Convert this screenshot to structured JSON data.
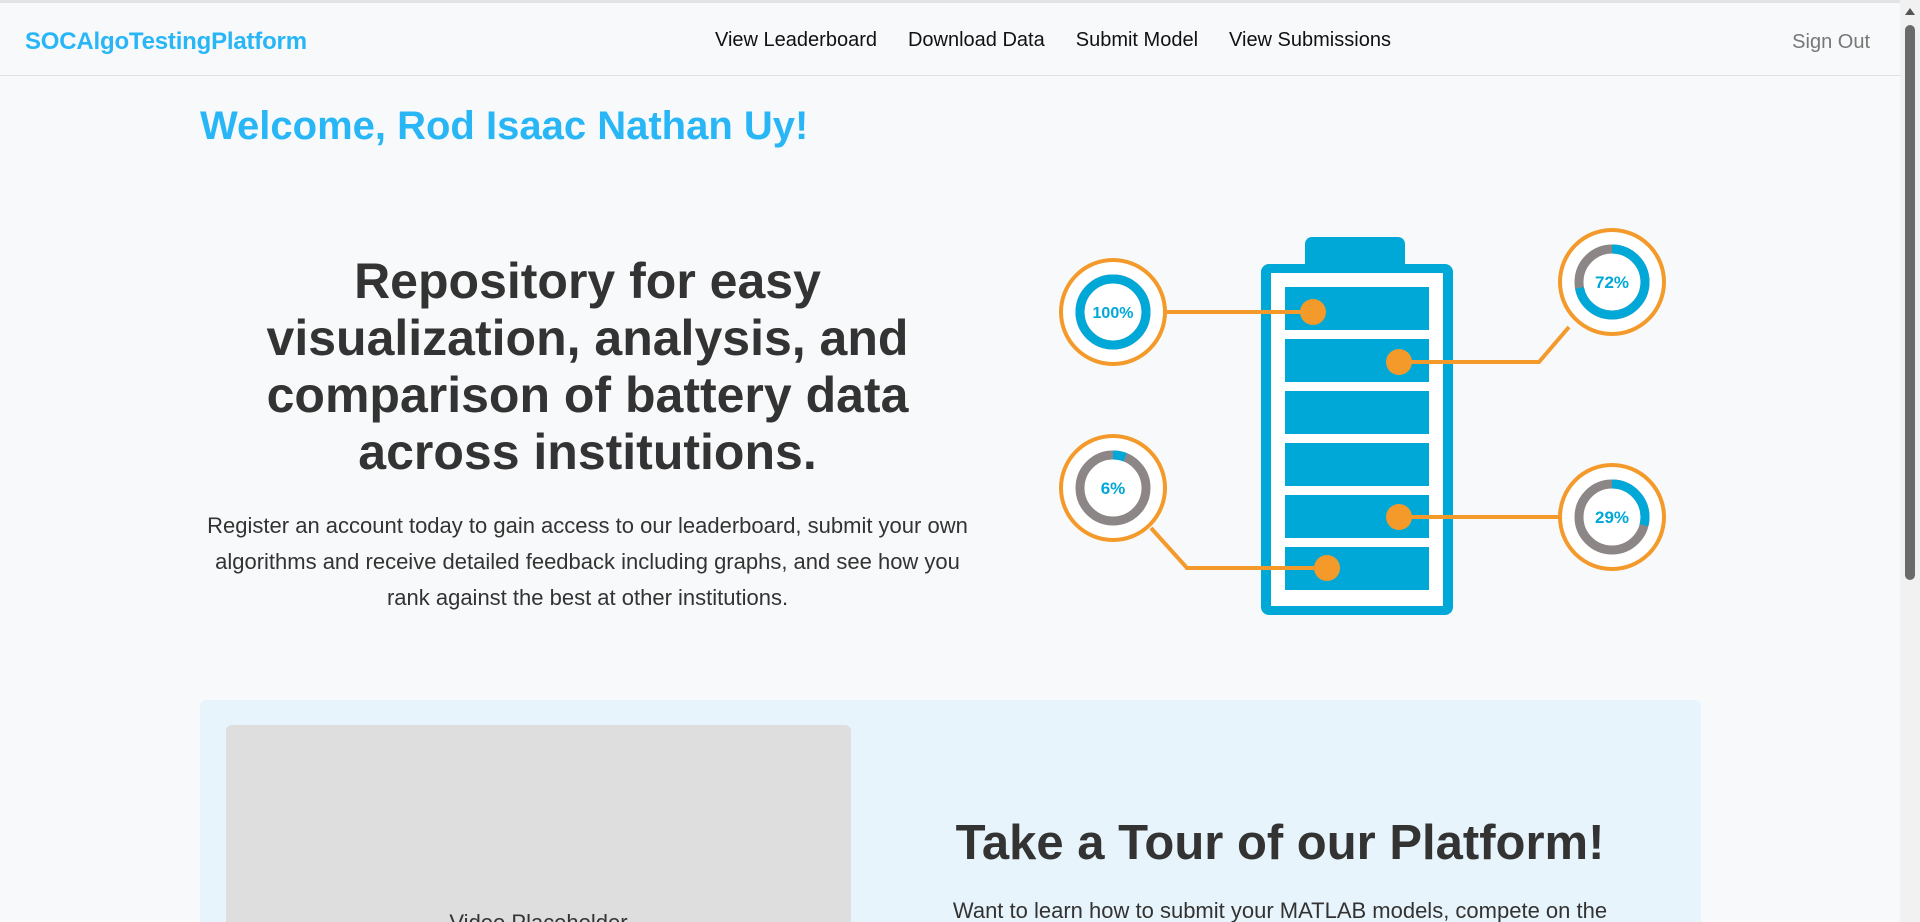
{
  "navbar": {
    "brand": "SOCAlgoTestingPlatform",
    "links": [
      "View Leaderboard",
      "Download Data",
      "Submit Model",
      "View Submissions"
    ],
    "sign_out": "Sign Out"
  },
  "welcome": "Welcome, Rod Isaac Nathan Uy!",
  "hero": {
    "title": "Repository for easy visualization, analysis, and comparison of battery data across institutions.",
    "description": "Register an account today to gain access to our leaderboard, submit your own algorithms and receive detailed feedback including graphs, and see how you rank against the best at other institutions."
  },
  "illustration": {
    "gauges": [
      {
        "label": "100%",
        "value": 100
      },
      {
        "label": "72%",
        "value": 72
      },
      {
        "label": "6%",
        "value": 6
      },
      {
        "label": "29%",
        "value": 29
      }
    ],
    "colors": {
      "battery": "#00a8d8",
      "connector": "#f39a2b",
      "gauge_empty": "#8c8686"
    }
  },
  "tour": {
    "video_label": "Video Placeholder",
    "title": "Take a Tour of our Platform!",
    "text": "Want to learn how to submit your MATLAB models, compete on the"
  }
}
